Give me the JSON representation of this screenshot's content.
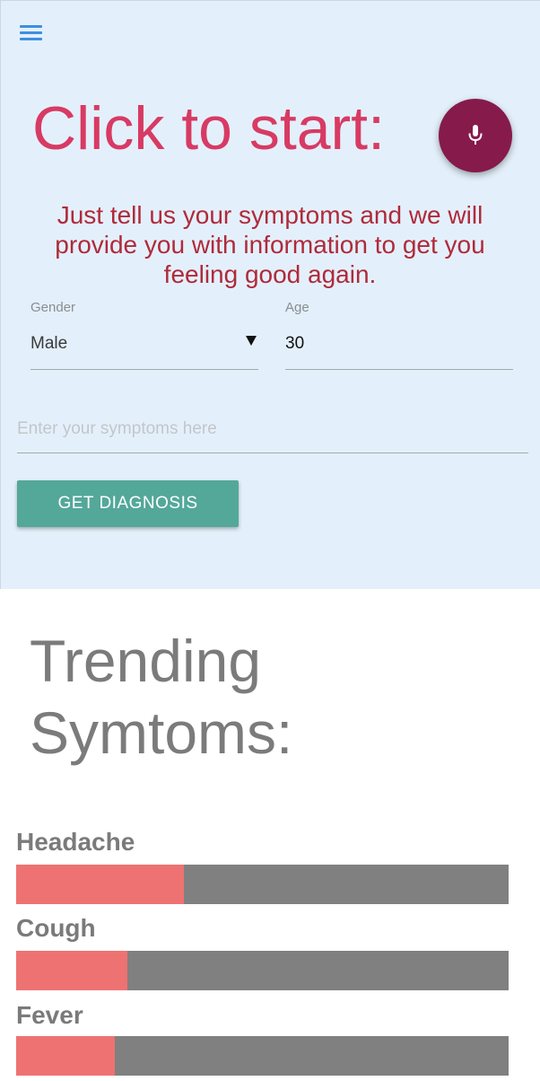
{
  "header": {
    "menu_icon": "hamburger-menu-icon",
    "headline": "Click to start:",
    "mic_icon": "microphone-icon",
    "tagline": "Just tell us your symptoms and we will provide you with information to get you feeling good again."
  },
  "form": {
    "gender_label": "Gender",
    "gender_value": "Male",
    "age_label": "Age",
    "age_value": "30",
    "symptoms_placeholder": "Enter your symptoms here",
    "submit_label": "GET DIAGNOSIS"
  },
  "trending": {
    "title": "Trending Symtoms:",
    "items": [
      {
        "name": "Headache",
        "level": 0.34
      },
      {
        "name": "Cough",
        "level": 0.225
      },
      {
        "name": "Fever",
        "level": 0.2
      }
    ]
  },
  "colors": {
    "top_background": "#e3f0fb",
    "headline": "#d83a63",
    "tagline": "#b02a3a",
    "mic_button": "#861a4b",
    "diagnosis_button": "#53a89a",
    "bar_fill": "#ef7272",
    "bar_track": "#808080",
    "menu_icon": "#3e8fe0"
  }
}
